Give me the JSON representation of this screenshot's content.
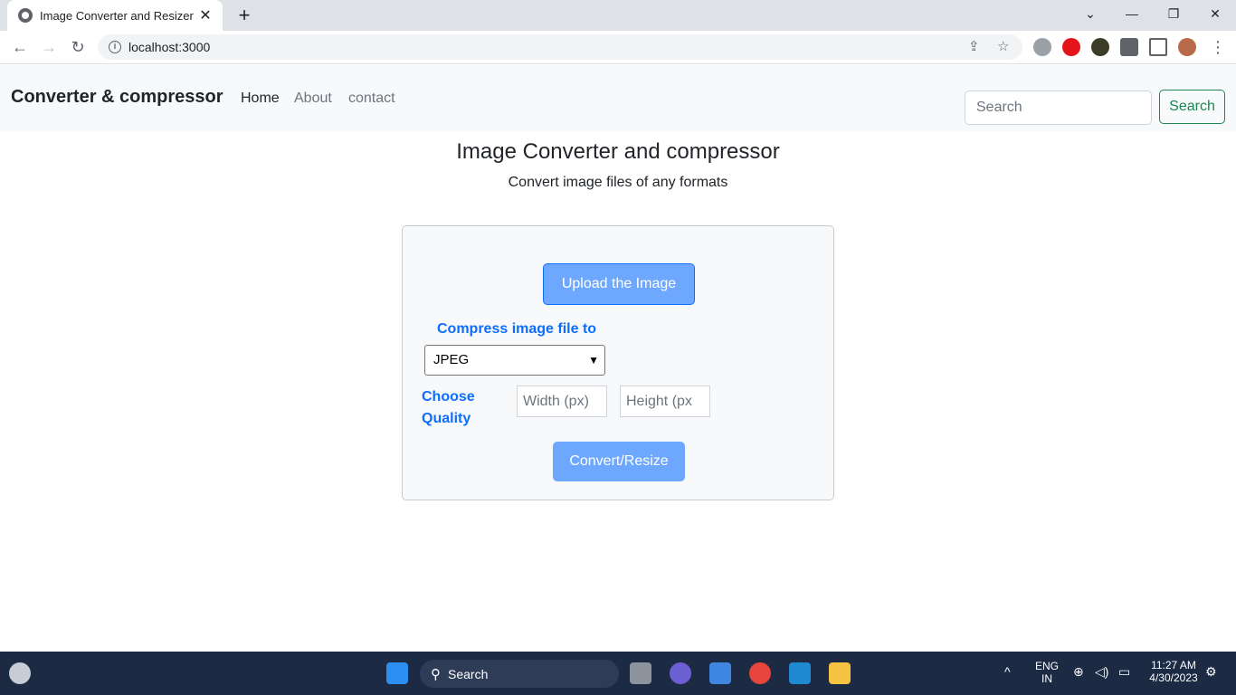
{
  "browser": {
    "tab_title": "Image Converter and Resizer",
    "url": "localhost:3000",
    "new_tab": "+",
    "tab_close": "✕"
  },
  "site_nav": {
    "brand": "Converter & compressor",
    "links": [
      "Home",
      "About",
      "contact"
    ],
    "search_placeholder": "Search",
    "search_button": "Search"
  },
  "hero": {
    "title": "Image Converter and compressor",
    "subtitle": "Convert image files of any formats"
  },
  "form": {
    "upload_button": "Upload the Image",
    "compress_label": "Compress image file to",
    "format_selected": "JPEG",
    "quality_label": "Choose Quality",
    "width_placeholder": "Width (px)",
    "height_placeholder": "Height (px",
    "convert_button": "Convert/Resize"
  },
  "taskbar": {
    "search_label": "Search",
    "lang": "ENG",
    "region": "IN",
    "time": "11:27 AM",
    "date": "4/30/2023"
  },
  "colors": {
    "primary": "#0d6efd",
    "primary_light": "#6ea8fe",
    "success": "#198754",
    "taskbar": "#1c2a44"
  }
}
